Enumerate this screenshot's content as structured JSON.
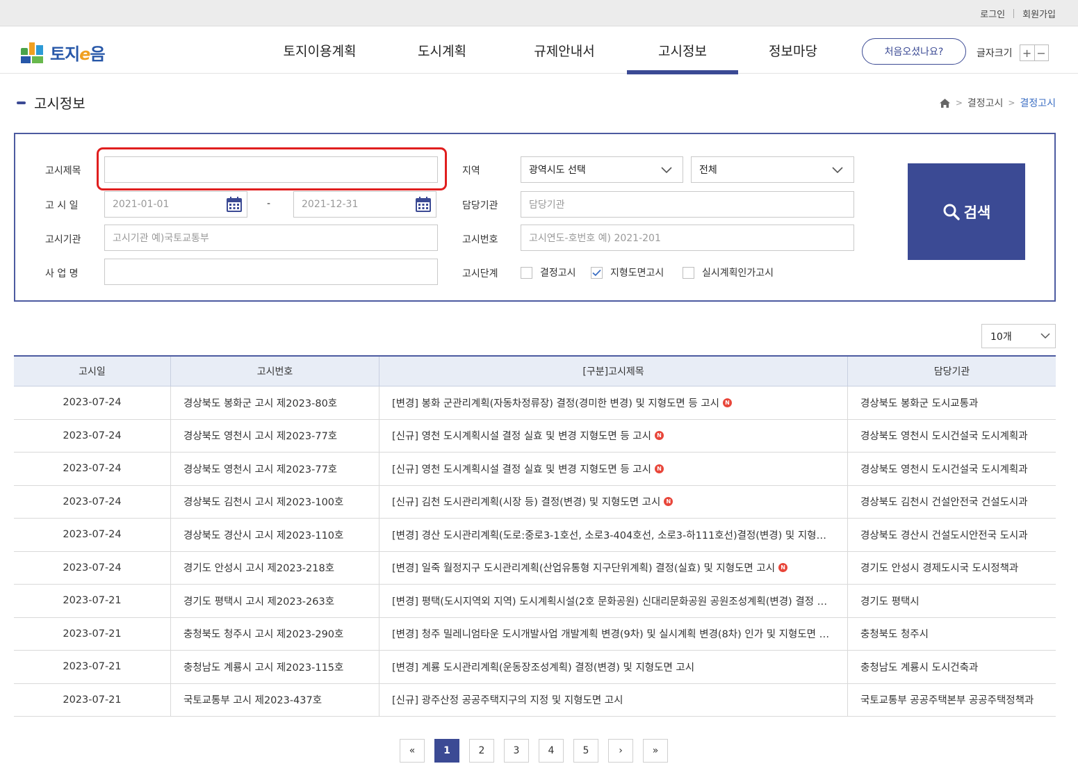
{
  "util_links": {
    "login": "로그인",
    "signup": "회원가입"
  },
  "logo": {
    "text_a": "토지",
    "text_e": "e",
    "text_b": "음"
  },
  "nav": [
    {
      "label": "토지이용계획"
    },
    {
      "label": "도시계획"
    },
    {
      "label": "규제안내서"
    },
    {
      "label": "고시정보"
    },
    {
      "label": "정보마당"
    }
  ],
  "header": {
    "first_visit": "처음오셨나요?",
    "font_size_label": "글자크기",
    "font_plus": "+",
    "font_minus": "−"
  },
  "page": {
    "title": "고시정보"
  },
  "breadcrumb": {
    "level1": "결정고시",
    "level2": "결정고시"
  },
  "search": {
    "title_label": "고시제목",
    "title_value": "",
    "date_label": "고 시 일",
    "date_from": "2021-01-01",
    "date_to": "2021-12-31",
    "date_sep": "-",
    "agency_label": "고시기관",
    "agency_placeholder": "고시기관  예)국토교통부",
    "project_label": "사 업 명",
    "project_value": "",
    "region_label": "지역",
    "region_select": "광역시도 선택",
    "region_sub_select": "전체",
    "dept_label": "담당기관",
    "dept_placeholder": "담당기관",
    "number_label": "고시번호",
    "number_placeholder": "고시연도-호번호  예) 2021-201",
    "stage_label": "고시단계",
    "stages": [
      {
        "label": "결정고시",
        "checked": false
      },
      {
        "label": "지형도면고시",
        "checked": true
      },
      {
        "label": "실시계획인가고시",
        "checked": false
      }
    ],
    "button": "검색"
  },
  "page_size": "10개",
  "table": {
    "headers": [
      "고시일",
      "고시번호",
      "[구분]고시제목",
      "담당기관"
    ],
    "rows": [
      {
        "date": "2023-07-24",
        "number": "경상북도 봉화군 고시 제2023-80호",
        "title": "[변경] 봉화 군관리계획(자동차정류장) 결정(경미한 변경) 및 지형도면 등 고시",
        "is_new": true,
        "agency": "경상북도 봉화군 도시교통과"
      },
      {
        "date": "2023-07-24",
        "number": "경상북도 영천시 고시 제2023-77호",
        "title": "[신규] 영천 도시계획시설 결정 실효 및 변경 지형도면 등 고시",
        "is_new": true,
        "agency": "경상북도 영천시 도시건설국 도시계획과"
      },
      {
        "date": "2023-07-24",
        "number": "경상북도 영천시 고시 제2023-77호",
        "title": "[신규] 영천 도시계획시설 결정 실효 및 변경 지형도면 등 고시",
        "is_new": true,
        "agency": "경상북도 영천시 도시건설국 도시계획과"
      },
      {
        "date": "2023-07-24",
        "number": "경상북도 김천시 고시 제2023-100호",
        "title": "[신규] 김천 도시관리계획(시장 등) 결정(변경) 및 지형도면 고시",
        "is_new": true,
        "agency": "경상북도 김천시 건설안전국 건설도시과"
      },
      {
        "date": "2023-07-24",
        "number": "경상북도 경산시 고시 제2023-110호",
        "title": "[변경] 경산 도시관리계획(도로:중로3-1호선, 소로3-404호선, 소로3-하111호선)결정(변경) 및 지형도면 고시",
        "is_new": false,
        "agency": "경상북도 경산시 건설도시안전국 도시과"
      },
      {
        "date": "2023-07-24",
        "number": "경기도 안성시 고시 제2023-218호",
        "title": "[변경] 일죽 월정지구 도시관리계획(산업유통형 지구단위계획) 결정(실효) 및 지형도면 고시",
        "is_new": true,
        "agency": "경기도 안성시 경제도시국 도시정책과"
      },
      {
        "date": "2023-07-21",
        "number": "경기도 평택시 고시 제2023-263호",
        "title": "[변경] 평택(도시지역외 지역) 도시계획시설(2호 문화공원) 신대리문화공원 공원조성계획(변경) 결정 고시",
        "is_new": false,
        "agency": "경기도 평택시"
      },
      {
        "date": "2023-07-21",
        "number": "충청북도 청주시 고시 제2023-290호",
        "title": "[변경] 청주 밀레니엄타운 도시개발사업 개발계획 변경(9차) 및 실시계획 변경(8차) 인가 및 지형도면 고시",
        "is_new": false,
        "agency": "충청북도 청주시"
      },
      {
        "date": "2023-07-21",
        "number": "충청남도 계룡시 고시 제2023-115호",
        "title": "[변경] 계룡 도시관리계획(운동장조성계획) 결정(변경) 및 지형도면 고시",
        "is_new": false,
        "agency": "충청남도 계룡시 도시건축과"
      },
      {
        "date": "2023-07-21",
        "number": "국토교통부 고시 제2023-437호",
        "title": "[신규] 광주산정 공공주택지구의 지정 및 지형도면 고시",
        "is_new": false,
        "agency": "국토교통부 공공주택본부 공공주택정책과"
      }
    ]
  },
  "pagination": {
    "first": "«",
    "prev": "‹",
    "pages": [
      "1",
      "2",
      "3",
      "4",
      "5"
    ],
    "current": "1",
    "next": "›",
    "last": "»"
  },
  "colors": {
    "primary": "#3b4a94",
    "highlight": "#e01e1e",
    "link": "#3b6ec3",
    "new_badge": "#e8463a"
  }
}
